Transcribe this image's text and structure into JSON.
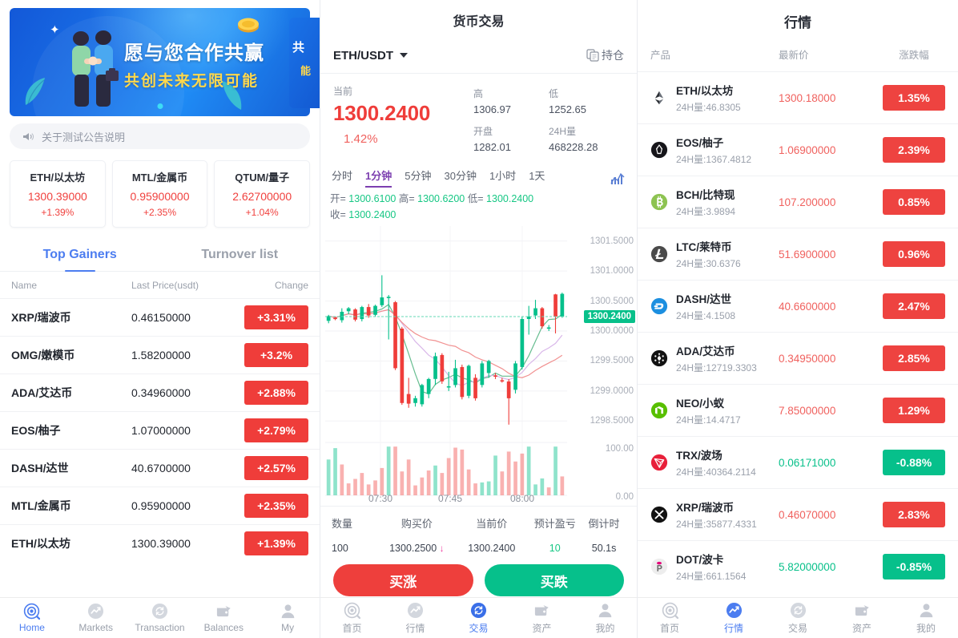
{
  "left": {
    "banner": {
      "line1": "愿与您合作共赢",
      "line2": "共创未来无限可能",
      "peek1": "共",
      "peek2": "能"
    },
    "notice": {
      "text": "关于测试公告说明",
      "icon": "speaker-icon"
    },
    "tickers": [
      {
        "name": "ETH/以太坊",
        "price": "1300.39000",
        "change": "+1.39%"
      },
      {
        "name": "MTL/金属币",
        "price": "0.95900000",
        "change": "+2.35%"
      },
      {
        "name": "QTUM/量子",
        "price": "2.62700000",
        "change": "+1.04%"
      }
    ],
    "tabs": [
      {
        "label": "Top Gainers",
        "active": true
      },
      {
        "label": "Turnover list",
        "active": false
      }
    ],
    "columns": {
      "name": "Name",
      "price": "Last Price(usdt)",
      "change": "Change"
    },
    "rows": [
      {
        "name": "XRP/瑞波币",
        "price": "0.46150000",
        "change": "+3.31%"
      },
      {
        "name": "OMG/嫩模币",
        "price": "1.58200000",
        "change": "+3.2%"
      },
      {
        "name": "ADA/艾达币",
        "price": "0.34960000",
        "change": "+2.88%"
      },
      {
        "name": "EOS/柚子",
        "price": "1.07000000",
        "change": "+2.79%"
      },
      {
        "name": "DASH/达世",
        "price": "40.6700000",
        "change": "+2.57%"
      },
      {
        "name": "MTL/金属币",
        "price": "0.95900000",
        "change": "+2.35%"
      },
      {
        "name": "ETH/以太坊",
        "price": "1300.39000",
        "change": "+1.39%"
      }
    ],
    "tabbar": [
      {
        "label": "Home",
        "icon": "home-icon",
        "active": true
      },
      {
        "label": "Markets",
        "icon": "markets-icon",
        "active": false
      },
      {
        "label": "Transaction",
        "icon": "transaction-icon",
        "active": false
      },
      {
        "label": "Balances",
        "icon": "wallet-icon",
        "active": false
      },
      {
        "label": "My",
        "icon": "user-icon",
        "active": false
      }
    ]
  },
  "mid": {
    "title": "货币交易",
    "symbol": "ETH/USDT",
    "positions_label": "持仓",
    "quote": {
      "current_label": "当前",
      "price": "1300.2400",
      "change": "1.42%",
      "high_label": "高",
      "high": "1306.97",
      "low_label": "低",
      "low": "1252.65",
      "open_label": "开盘",
      "open": "1282.01",
      "vol_label": "24H量",
      "vol": "468228.28"
    },
    "timeframes": [
      {
        "label": "分时",
        "active": false
      },
      {
        "label": "1分钟",
        "active": true
      },
      {
        "label": "5分钟",
        "active": false
      },
      {
        "label": "30分钟",
        "active": false
      },
      {
        "label": "1小时",
        "active": false
      },
      {
        "label": "1天",
        "active": false
      }
    ],
    "ohlc": {
      "o_label": "开=",
      "o": "1300.6100",
      "h_label": "高=",
      "h": "1300.6200",
      "l_label": "低=",
      "l": "1300.2400",
      "c_label": "收=",
      "c": "1300.2400"
    },
    "trade_head": {
      "qty": "数量",
      "buy_price": "购买价",
      "cur_price": "当前价",
      "pnl": "预计盈亏",
      "countdown": "倒计时"
    },
    "trade_row": {
      "qty": "100",
      "buy_price": "1300.2500",
      "cur_price": "1300.2400",
      "pnl": "10",
      "countdown": "50.1s"
    },
    "buttons": {
      "up": "买涨",
      "down": "买跌"
    },
    "tabbar": [
      {
        "label": "首页",
        "icon": "home-icon",
        "active": false
      },
      {
        "label": "行情",
        "icon": "markets-icon",
        "active": false
      },
      {
        "label": "交易",
        "icon": "transaction-icon",
        "active": true
      },
      {
        "label": "资产",
        "icon": "wallet-icon",
        "active": false
      },
      {
        "label": "我的",
        "icon": "user-icon",
        "active": false
      }
    ]
  },
  "right": {
    "title": "行情",
    "columns": {
      "product": "产品",
      "price": "最新价",
      "change": "涨跌幅"
    },
    "rows": [
      {
        "name": "ETH/以太坊",
        "vol": "24H量:46.8305",
        "price": "1300.18000",
        "change": "1.35%",
        "neg": false,
        "icon": "eth-icon"
      },
      {
        "name": "EOS/柚子",
        "vol": "24H量:1367.4812",
        "price": "1.06900000",
        "change": "2.39%",
        "neg": false,
        "icon": "eos-icon"
      },
      {
        "name": "BCH/比特现",
        "vol": "24H量:3.9894",
        "price": "107.200000",
        "change": "0.85%",
        "neg": false,
        "icon": "bch-icon"
      },
      {
        "name": "LTC/莱特币",
        "vol": "24H量:30.6376",
        "price": "51.6900000",
        "change": "0.96%",
        "neg": false,
        "icon": "ltc-icon"
      },
      {
        "name": "DASH/达世",
        "vol": "24H量:4.1508",
        "price": "40.6600000",
        "change": "2.47%",
        "neg": false,
        "icon": "dash-icon"
      },
      {
        "name": "ADA/艾达币",
        "vol": "24H量:12719.3303",
        "price": "0.34950000",
        "change": "2.85%",
        "neg": false,
        "icon": "ada-icon"
      },
      {
        "name": "NEO/小蚁",
        "vol": "24H量:14.4717",
        "price": "7.85000000",
        "change": "1.29%",
        "neg": false,
        "icon": "neo-icon"
      },
      {
        "name": "TRX/波场",
        "vol": "24H量:40364.2114",
        "price": "0.06171000",
        "change": "-0.88%",
        "neg": true,
        "icon": "trx-icon"
      },
      {
        "name": "XRP/瑞波币",
        "vol": "24H量:35877.4331",
        "price": "0.46070000",
        "change": "2.83%",
        "neg": false,
        "icon": "xrp-icon"
      },
      {
        "name": "DOT/波卡",
        "vol": "24H量:661.1564",
        "price": "5.82000000",
        "change": "-0.85%",
        "neg": true,
        "icon": "dot-icon"
      }
    ],
    "tabbar": [
      {
        "label": "首页",
        "icon": "home-icon",
        "active": false
      },
      {
        "label": "行情",
        "icon": "markets-icon",
        "active": true
      },
      {
        "label": "交易",
        "icon": "transaction-icon",
        "active": false
      },
      {
        "label": "资产",
        "icon": "wallet-icon",
        "active": false
      },
      {
        "label": "我的",
        "icon": "user-icon",
        "active": false
      }
    ]
  },
  "chart_data": {
    "type": "candlestick",
    "title": "ETH/USDT 1分钟",
    "xlabel": "",
    "ylabel": "",
    "ylim": [
      1298.25,
      1301.75
    ],
    "yticks": [
      "1301.5000",
      "1301.0000",
      "1300.5000",
      "1300.0000",
      "1299.5000",
      "1299.0000",
      "1298.5000"
    ],
    "xticks": [
      "07:30",
      "07:45",
      "08:00"
    ],
    "current_price_marker": "1300.2400",
    "volume_yticks": [
      "100.00",
      "0.00"
    ],
    "grid": true,
    "up_color": "#06c08b",
    "down_color": "#ef3d3a",
    "ma_colors": [
      "#f08b8b",
      "#d7b3e8",
      "#5fb98a"
    ],
    "candles": [
      {
        "o": 1300.17,
        "h": 1300.27,
        "l": 1300.13,
        "c": 1300.25
      },
      {
        "o": 1300.22,
        "h": 1300.24,
        "l": 1300.18,
        "c": 1300.2
      },
      {
        "o": 1300.18,
        "h": 1300.38,
        "l": 1300.14,
        "c": 1300.32
      },
      {
        "o": 1300.33,
        "h": 1300.4,
        "l": 1300.28,
        "c": 1300.38
      },
      {
        "o": 1300.36,
        "h": 1300.38,
        "l": 1300.16,
        "c": 1300.19
      },
      {
        "o": 1300.2,
        "h": 1300.42,
        "l": 1300.16,
        "c": 1300.4
      },
      {
        "o": 1300.4,
        "h": 1300.45,
        "l": 1300.22,
        "c": 1300.26
      },
      {
        "o": 1300.27,
        "h": 1300.44,
        "l": 1300.24,
        "c": 1300.42
      },
      {
        "o": 1300.43,
        "h": 1300.93,
        "l": 1300.4,
        "c": 1300.56
      },
      {
        "o": 1300.56,
        "h": 1300.6,
        "l": 1299.86,
        "c": 1300.57
      },
      {
        "o": 1300.48,
        "h": 1300.5,
        "l": 1299.35,
        "c": 1299.38
      },
      {
        "o": 1300.04,
        "h": 1300.07,
        "l": 1298.77,
        "c": 1298.8
      },
      {
        "o": 1298.95,
        "h": 1299.22,
        "l": 1298.72,
        "c": 1298.79
      },
      {
        "o": 1298.8,
        "h": 1298.92,
        "l": 1298.74,
        "c": 1298.88
      },
      {
        "o": 1298.78,
        "h": 1299.12,
        "l": 1298.74,
        "c": 1299.1
      },
      {
        "o": 1298.95,
        "h": 1299.22,
        "l": 1298.88,
        "c": 1299.2
      },
      {
        "o": 1299.2,
        "h": 1299.64,
        "l": 1299.1,
        "c": 1299.58
      },
      {
        "o": 1299.6,
        "h": 1299.63,
        "l": 1299.12,
        "c": 1299.16
      },
      {
        "o": 1299.06,
        "h": 1299.32,
        "l": 1299.0,
        "c": 1299.08
      },
      {
        "o": 1299.1,
        "h": 1299.52,
        "l": 1299.06,
        "c": 1299.38
      },
      {
        "o": 1299.4,
        "h": 1299.44,
        "l": 1298.86,
        "c": 1298.9
      },
      {
        "o": 1298.92,
        "h": 1299.44,
        "l": 1298.88,
        "c": 1299.42
      },
      {
        "o": 1299.22,
        "h": 1299.28,
        "l": 1298.84,
        "c": 1298.88
      },
      {
        "o": 1299.1,
        "h": 1299.5,
        "l": 1299.06,
        "c": 1299.46
      },
      {
        "o": 1299.3,
        "h": 1299.52,
        "l": 1299.22,
        "c": 1299.5
      },
      {
        "o": 1299.26,
        "h": 1299.3,
        "l": 1299.2,
        "c": 1299.24
      },
      {
        "o": 1299.18,
        "h": 1299.22,
        "l": 1299.14,
        "c": 1299.16
      },
      {
        "o": 1299.16,
        "h": 1299.2,
        "l": 1298.44,
        "c": 1298.88
      },
      {
        "o": 1299.02,
        "h": 1299.5,
        "l": 1298.96,
        "c": 1299.46
      },
      {
        "o": 1299.4,
        "h": 1300.24,
        "l": 1299.36,
        "c": 1300.2
      },
      {
        "o": 1300.2,
        "h": 1300.42,
        "l": 1299.94,
        "c": 1300.24
      },
      {
        "o": 1300.26,
        "h": 1300.52,
        "l": 1300.2,
        "c": 1300.38
      },
      {
        "o": 1300.38,
        "h": 1300.4,
        "l": 1300.04,
        "c": 1300.08
      },
      {
        "o": 1300.04,
        "h": 1300.1,
        "l": 1300.0,
        "c": 1300.06
      },
      {
        "o": 1300.61,
        "h": 1300.62,
        "l": 1299.96,
        "c": 1300.24
      },
      {
        "o": 1300.24,
        "h": 1300.64,
        "l": 1300.22,
        "c": 1300.62
      }
    ],
    "volumes": [
      72,
      95,
      62,
      24,
      33,
      45,
      22,
      30,
      55,
      98,
      98,
      48,
      72,
      20,
      36,
      50,
      60,
      45,
      75,
      96,
      92,
      52,
      24,
      26,
      28,
      80,
      48,
      88,
      68,
      84,
      98,
      22,
      34,
      16,
      98,
      38
    ],
    "volume_up": [
      true,
      true,
      false,
      false,
      false,
      false,
      false,
      false,
      false,
      true,
      false,
      false,
      false,
      false,
      false,
      false,
      true,
      false,
      false,
      false,
      false,
      false,
      false,
      true,
      true,
      true,
      false,
      false,
      false,
      false,
      true,
      true,
      true,
      false,
      true,
      false
    ]
  }
}
